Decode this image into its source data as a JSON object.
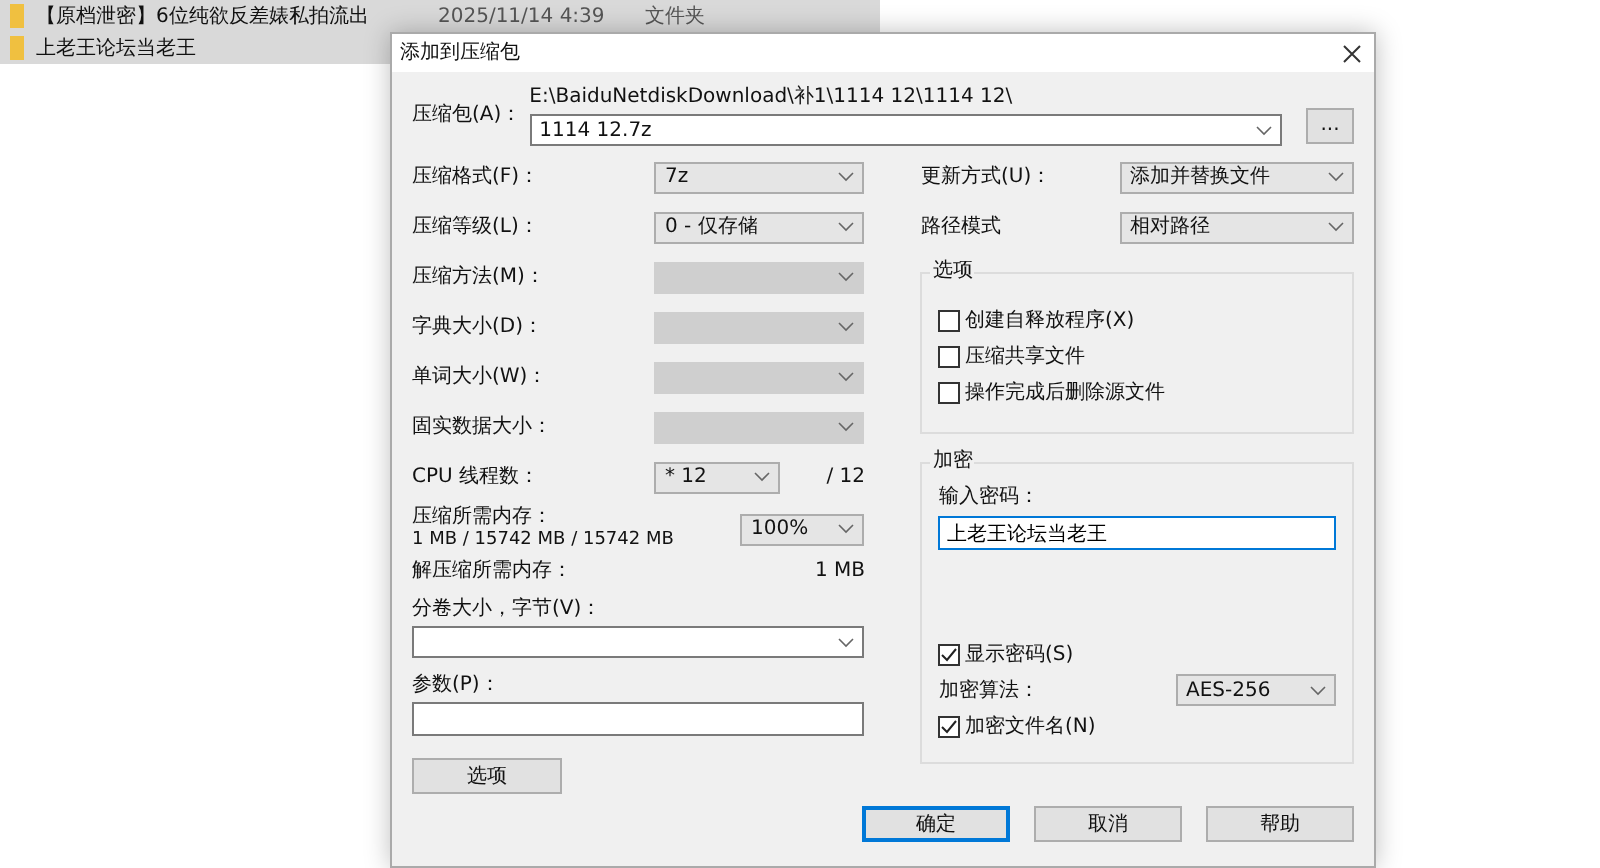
{
  "background_files": [
    {
      "name": "【原档泄密】6位纯欲反差婊私拍流出",
      "date": "2025/11/14 4:39",
      "type": "文件夹"
    },
    {
      "name": "上老王论坛当老王"
    }
  ],
  "dialog": {
    "title": "添加到压缩包",
    "archive": {
      "label": "压缩包(A)：",
      "path": "E:\\BaiduNetdiskDownload\\补1\\1114 12\\1114 12\\",
      "filename": "1114 12.7z",
      "browse_button": "..."
    },
    "left_rows": [
      {
        "kind": "select",
        "label": "压缩格式(F)：",
        "value": "7z",
        "disabled": false
      },
      {
        "kind": "select",
        "label": "压缩等级(L)：",
        "value": "0 - 仅存储",
        "disabled": false
      },
      {
        "kind": "select",
        "label": "压缩方法(M)：",
        "disabled": true
      },
      {
        "kind": "select",
        "label": "字典大小(D)：",
        "disabled": true
      },
      {
        "kind": "select",
        "label": "单词大小(W)：",
        "disabled": true
      },
      {
        "kind": "select",
        "label": "固实数据大小：",
        "disabled": true
      },
      {
        "kind": "threads",
        "label": "CPU 线程数：",
        "value": "* 12",
        "total": "/ 12"
      },
      {
        "kind": "memory",
        "label": "压缩所需内存：",
        "detail": "1 MB / 15742 MB / 15742 MB",
        "value": "100%"
      },
      {
        "kind": "info",
        "label": "解压缩所需内存：",
        "value": "1 MB"
      }
    ],
    "volume": {
      "label": "分卷大小，字节(V)："
    },
    "parameters": {
      "label": "参数(P)："
    },
    "options_button": "选项",
    "update_mode": {
      "label": "更新方式(U)：",
      "value": "添加并替换文件"
    },
    "path_mode": {
      "label": "路径模式",
      "value": "相对路径"
    },
    "options_group": {
      "title": "选项",
      "items": [
        {
          "label": "创建自释放程序(X)",
          "checked": false
        },
        {
          "label": "压缩共享文件",
          "checked": false
        },
        {
          "label": "操作完成后删除源文件",
          "checked": false
        }
      ]
    },
    "encryption": {
      "title": "加密",
      "password_label": "输入密码：",
      "password": "上老王论坛当老王",
      "show_password": {
        "label": "显示密码(S)",
        "checked": true
      },
      "method_label": "加密算法：",
      "method": "AES-256",
      "encrypt_names": {
        "label": "加密文件名(N)",
        "checked": true
      }
    },
    "buttons": [
      {
        "label": "确定",
        "focused": true
      },
      {
        "label": "取消",
        "focused": false
      },
      {
        "label": "帮助",
        "focused": false
      }
    ]
  }
}
